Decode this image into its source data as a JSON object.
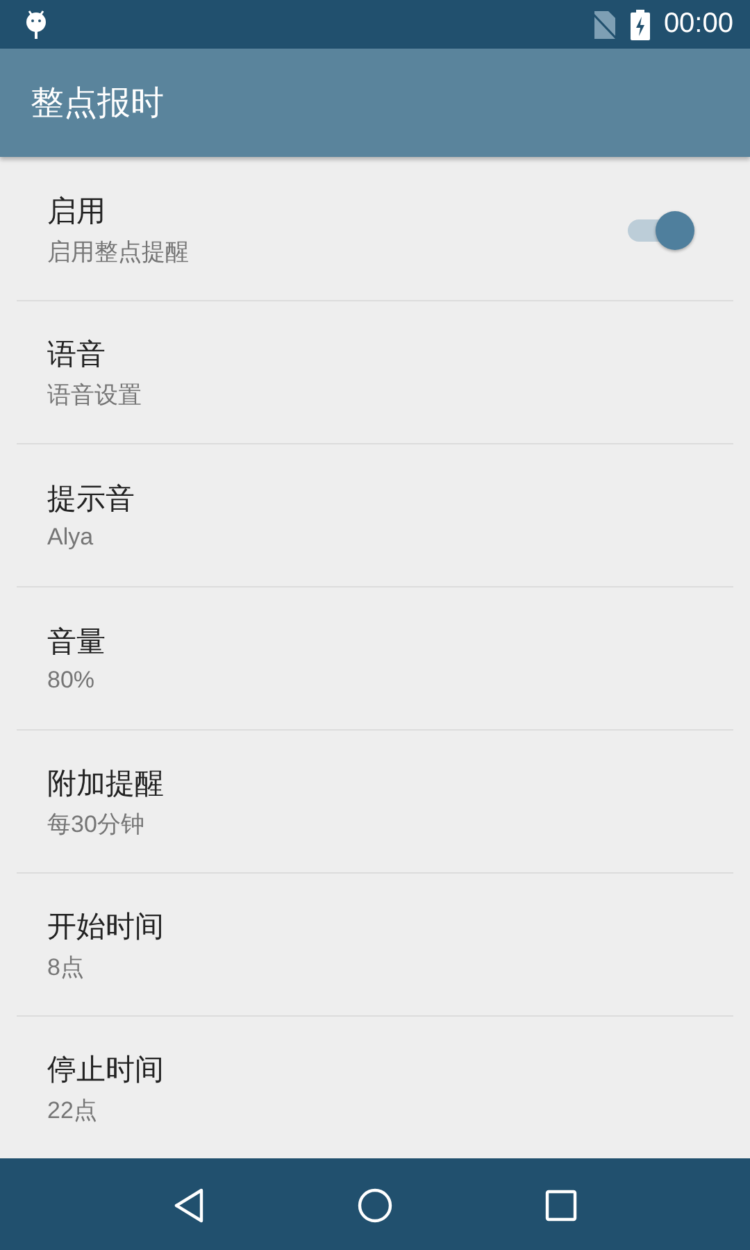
{
  "status_bar": {
    "time": "00:00"
  },
  "app_bar": {
    "title": "整点报时"
  },
  "settings": [
    {
      "kind": "switch",
      "title": "启用",
      "summary": "启用整点提醒",
      "on": true
    },
    {
      "kind": "text",
      "title": "语音",
      "summary": "语音设置"
    },
    {
      "kind": "text",
      "title": "提示音",
      "summary": "Alya"
    },
    {
      "kind": "text",
      "title": "音量",
      "summary": "80%"
    },
    {
      "kind": "text",
      "title": "附加提醒",
      "summary": "每30分钟"
    },
    {
      "kind": "text",
      "title": "开始时间",
      "summary": "8点"
    },
    {
      "kind": "text",
      "title": "停止时间",
      "summary": "22点"
    }
  ]
}
